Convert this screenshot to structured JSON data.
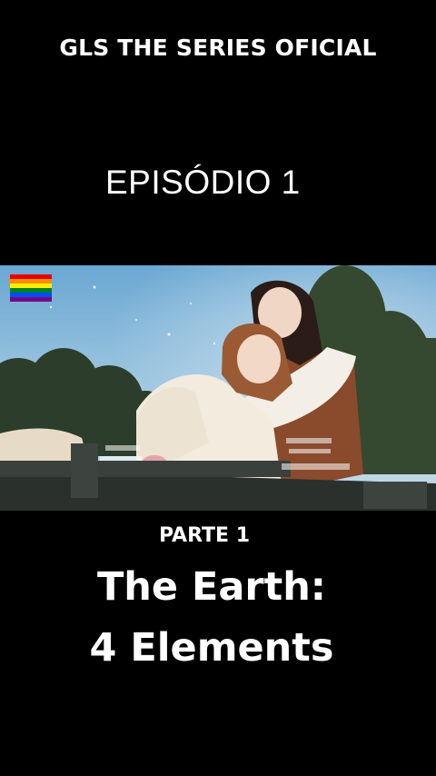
{
  "header": {
    "channel_title": "GLS THE SERIES OFICIAL",
    "episode_label": "EPISÓDIO 1"
  },
  "video": {
    "overlay_flag": "rainbow-flag-emoji",
    "scene": "two women embracing on a rooftop under an evening sky"
  },
  "footer": {
    "part_label": "PARTE 1",
    "title_line_1": "The Earth:",
    "title_line_2": "4 Elements"
  },
  "colors": {
    "background": "#000000",
    "text": "#ffffff",
    "sky": "#7fb6d8"
  }
}
